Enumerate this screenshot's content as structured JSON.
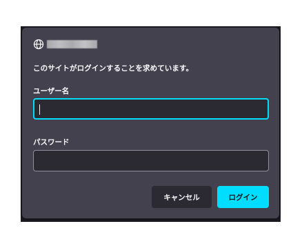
{
  "dialog": {
    "origin_icon": "globe-icon",
    "message": "このサイトがログインすることを求めています。",
    "username": {
      "label": "ユーザー名",
      "value": ""
    },
    "password": {
      "label": "パスワード",
      "value": ""
    },
    "buttons": {
      "cancel": "キャンセル",
      "login": "ログイン"
    }
  },
  "colors": {
    "dialog_bg": "#42414d",
    "input_bg": "#2b2a33",
    "accent": "#00ddff",
    "text": "#fbfbfe"
  }
}
